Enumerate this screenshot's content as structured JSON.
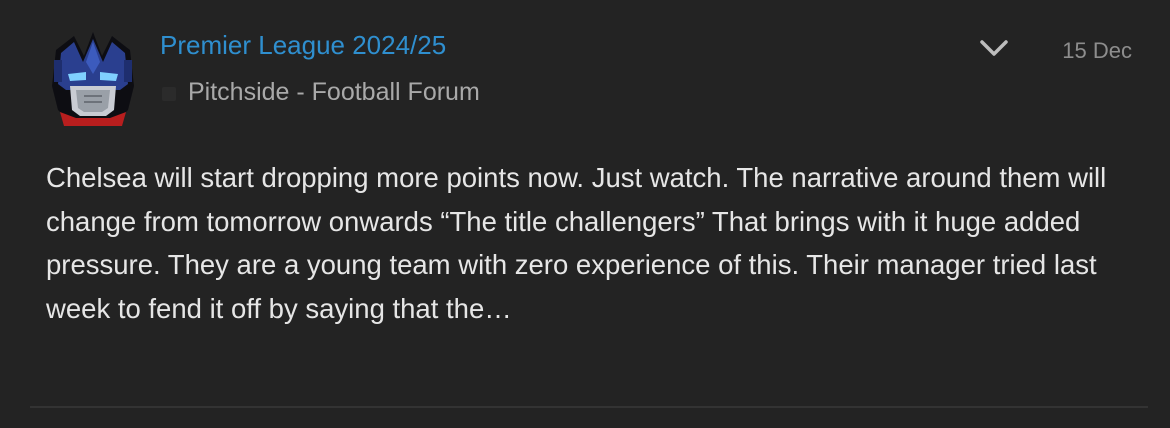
{
  "post": {
    "thread_title": "Premier League 2024/25",
    "forum_name": "Pitchside - Football Forum",
    "date": "15 Dec",
    "excerpt": "Chelsea will start dropping more points now. Just watch. The narrative around them will change from tomorrow onwards “The title challengers” That brings with it huge added pressure. They are a young team with zero experience of this. Their manager tried last week to fend it off by saying that the…",
    "avatar_icon": "robot-avatar-icon",
    "expand_icon": "chevron-down-icon"
  },
  "colors": {
    "background": "#232323",
    "link": "#2f8fcf",
    "text": "#e6e6e6",
    "muted": "#a9a9a9"
  }
}
